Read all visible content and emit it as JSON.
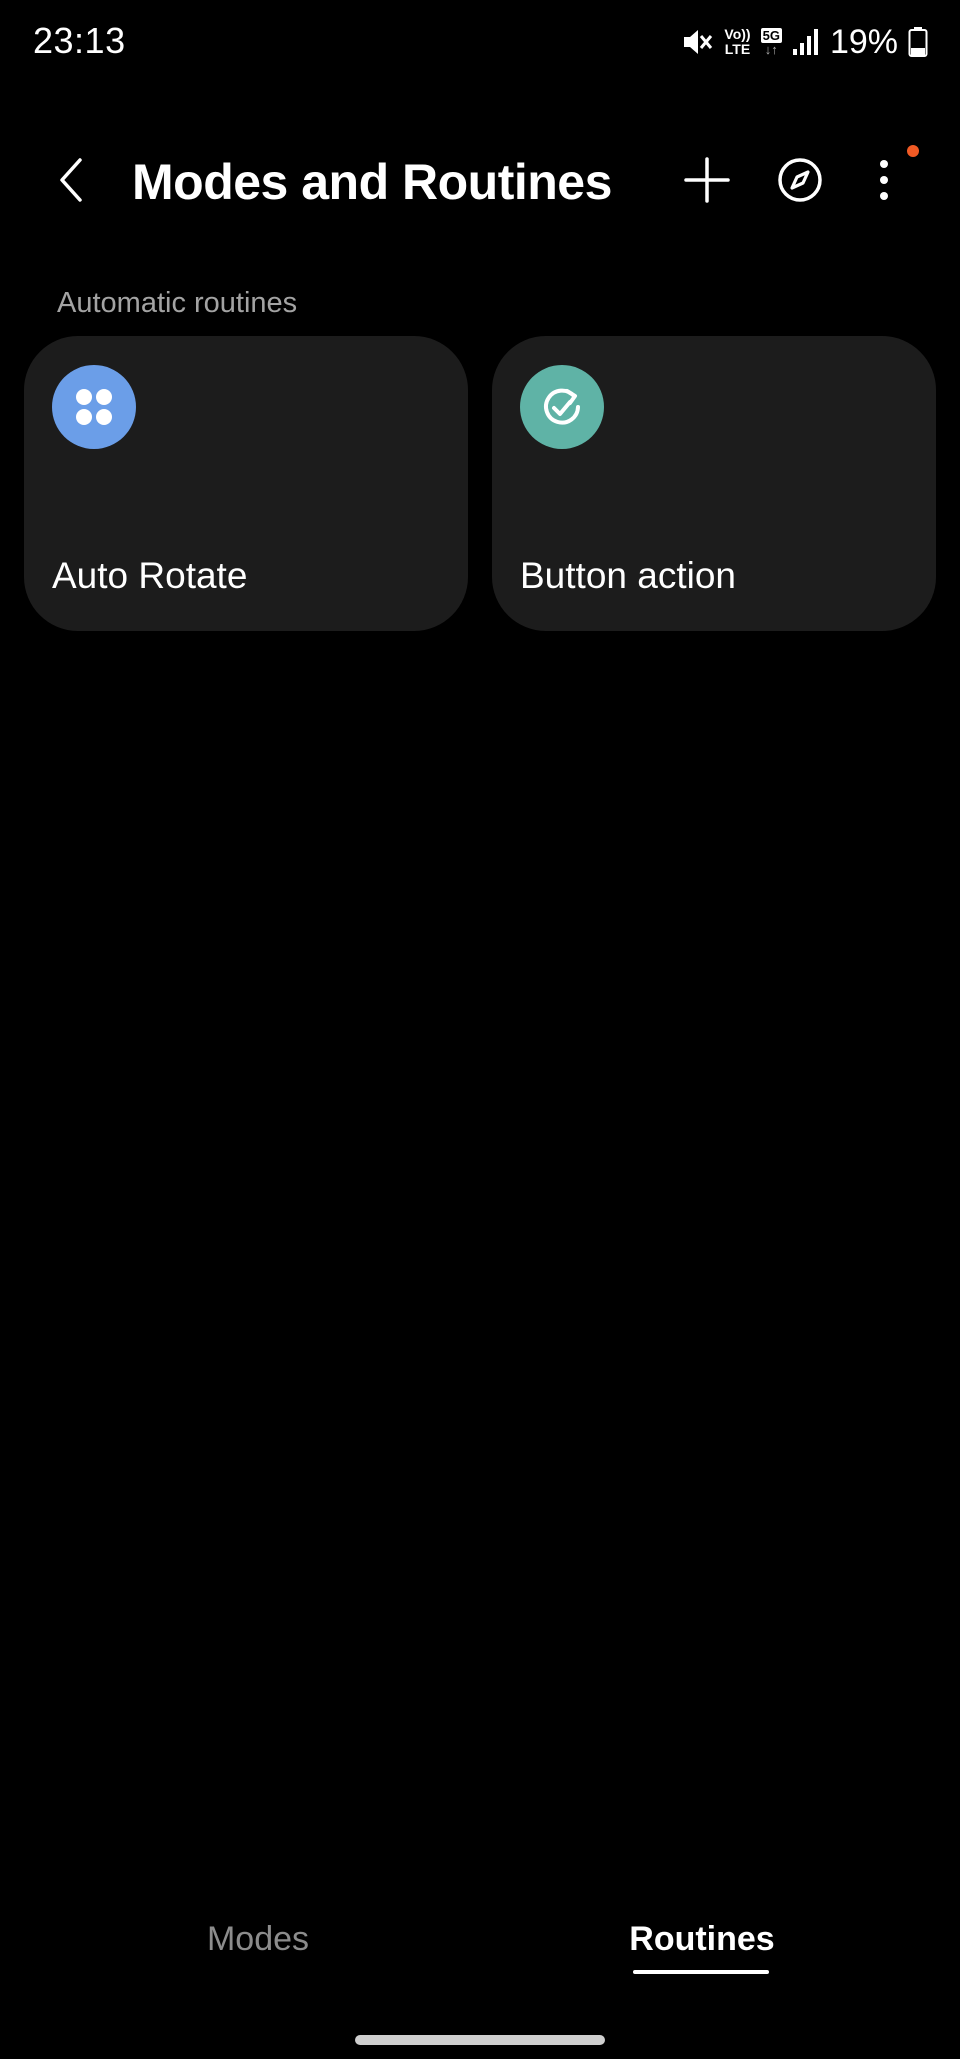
{
  "status_bar": {
    "time": "23:13",
    "volte_top": "Vo))",
    "volte_bottom": "LTE",
    "network": "5G",
    "network_arrows": "↓↑",
    "battery_percent": "19%",
    "icons": [
      "mute-icon",
      "volte-icon",
      "5g-icon",
      "signal-icon",
      "battery-icon"
    ]
  },
  "app_bar": {
    "title": "Modes and Routines",
    "icons": [
      "back-icon",
      "plus-icon",
      "compass-icon",
      "more-vert-icon"
    ],
    "notification_dot_color": "#f15a24"
  },
  "section": {
    "header": "Automatic routines",
    "cards": [
      {
        "label": "Auto Rotate",
        "icon": "apps-grid-icon",
        "icon_color": "#6b9ee8"
      },
      {
        "label": "Button action",
        "icon": "check-refresh-icon",
        "icon_color": "#5fb3a6"
      }
    ]
  },
  "tabs": {
    "modes": "Modes",
    "routines": "Routines",
    "selected": "Routines"
  },
  "colors": {
    "background": "#000000",
    "card": "#1c1c1c",
    "muted_text": "#a3a3a3"
  }
}
